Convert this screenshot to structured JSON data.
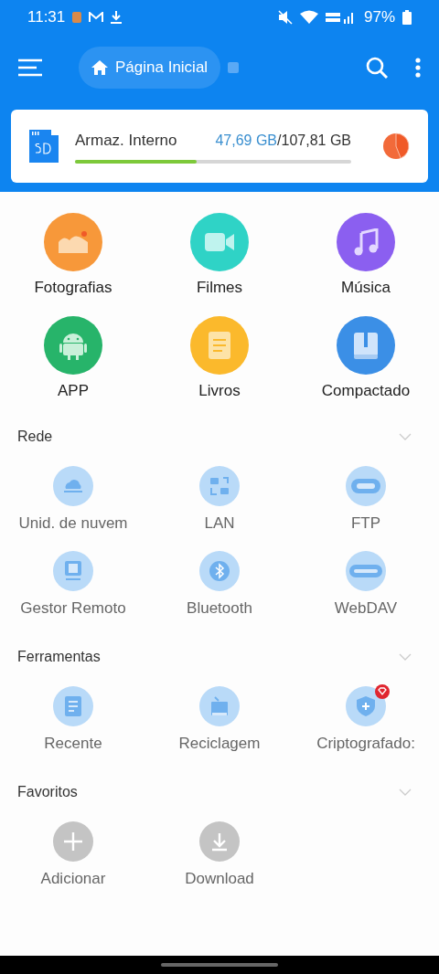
{
  "status_bar": {
    "time": "11:31",
    "battery": "97%"
  },
  "toolbar": {
    "breadcrumb": "Página Inicial"
  },
  "storage": {
    "name": "Armaz. Interno",
    "used": "47,69 GB",
    "total": "/107,81 GB",
    "level": 0.44
  },
  "categories": [
    {
      "label": "Fotografias",
      "color": "#f7983a"
    },
    {
      "label": "Filmes",
      "color": "#2fd3c6"
    },
    {
      "label": "Música",
      "color": "#8b5ff0"
    },
    {
      "label": "APP",
      "color": "#27b46a"
    },
    {
      "label": "Livros",
      "color": "#fbb92c"
    },
    {
      "label": "Compactado",
      "color": "#3b8fe6"
    }
  ],
  "sections": [
    {
      "title": "Rede",
      "expanded": true,
      "items": [
        {
          "label": "Unid. de nuvem",
          "badge": false
        },
        {
          "label": "LAN",
          "badge": false
        },
        {
          "label": "FTP",
          "badge": false
        },
        {
          "label": "Gestor Remoto",
          "badge": false
        },
        {
          "label": "Bluetooth",
          "badge": false
        },
        {
          "label": "WebDAV",
          "badge": false
        }
      ]
    },
    {
      "title": "Ferramentas",
      "expanded": true,
      "items": [
        {
          "label": "Recente",
          "badge": false
        },
        {
          "label": "Reciclagem",
          "badge": false
        },
        {
          "label": "Criptografado:",
          "badge": true
        }
      ]
    },
    {
      "title": "Favoritos",
      "expanded": true,
      "items": [
        {
          "label": "Adicionar",
          "badge": false
        },
        {
          "label": "Download",
          "badge": false
        }
      ]
    }
  ]
}
